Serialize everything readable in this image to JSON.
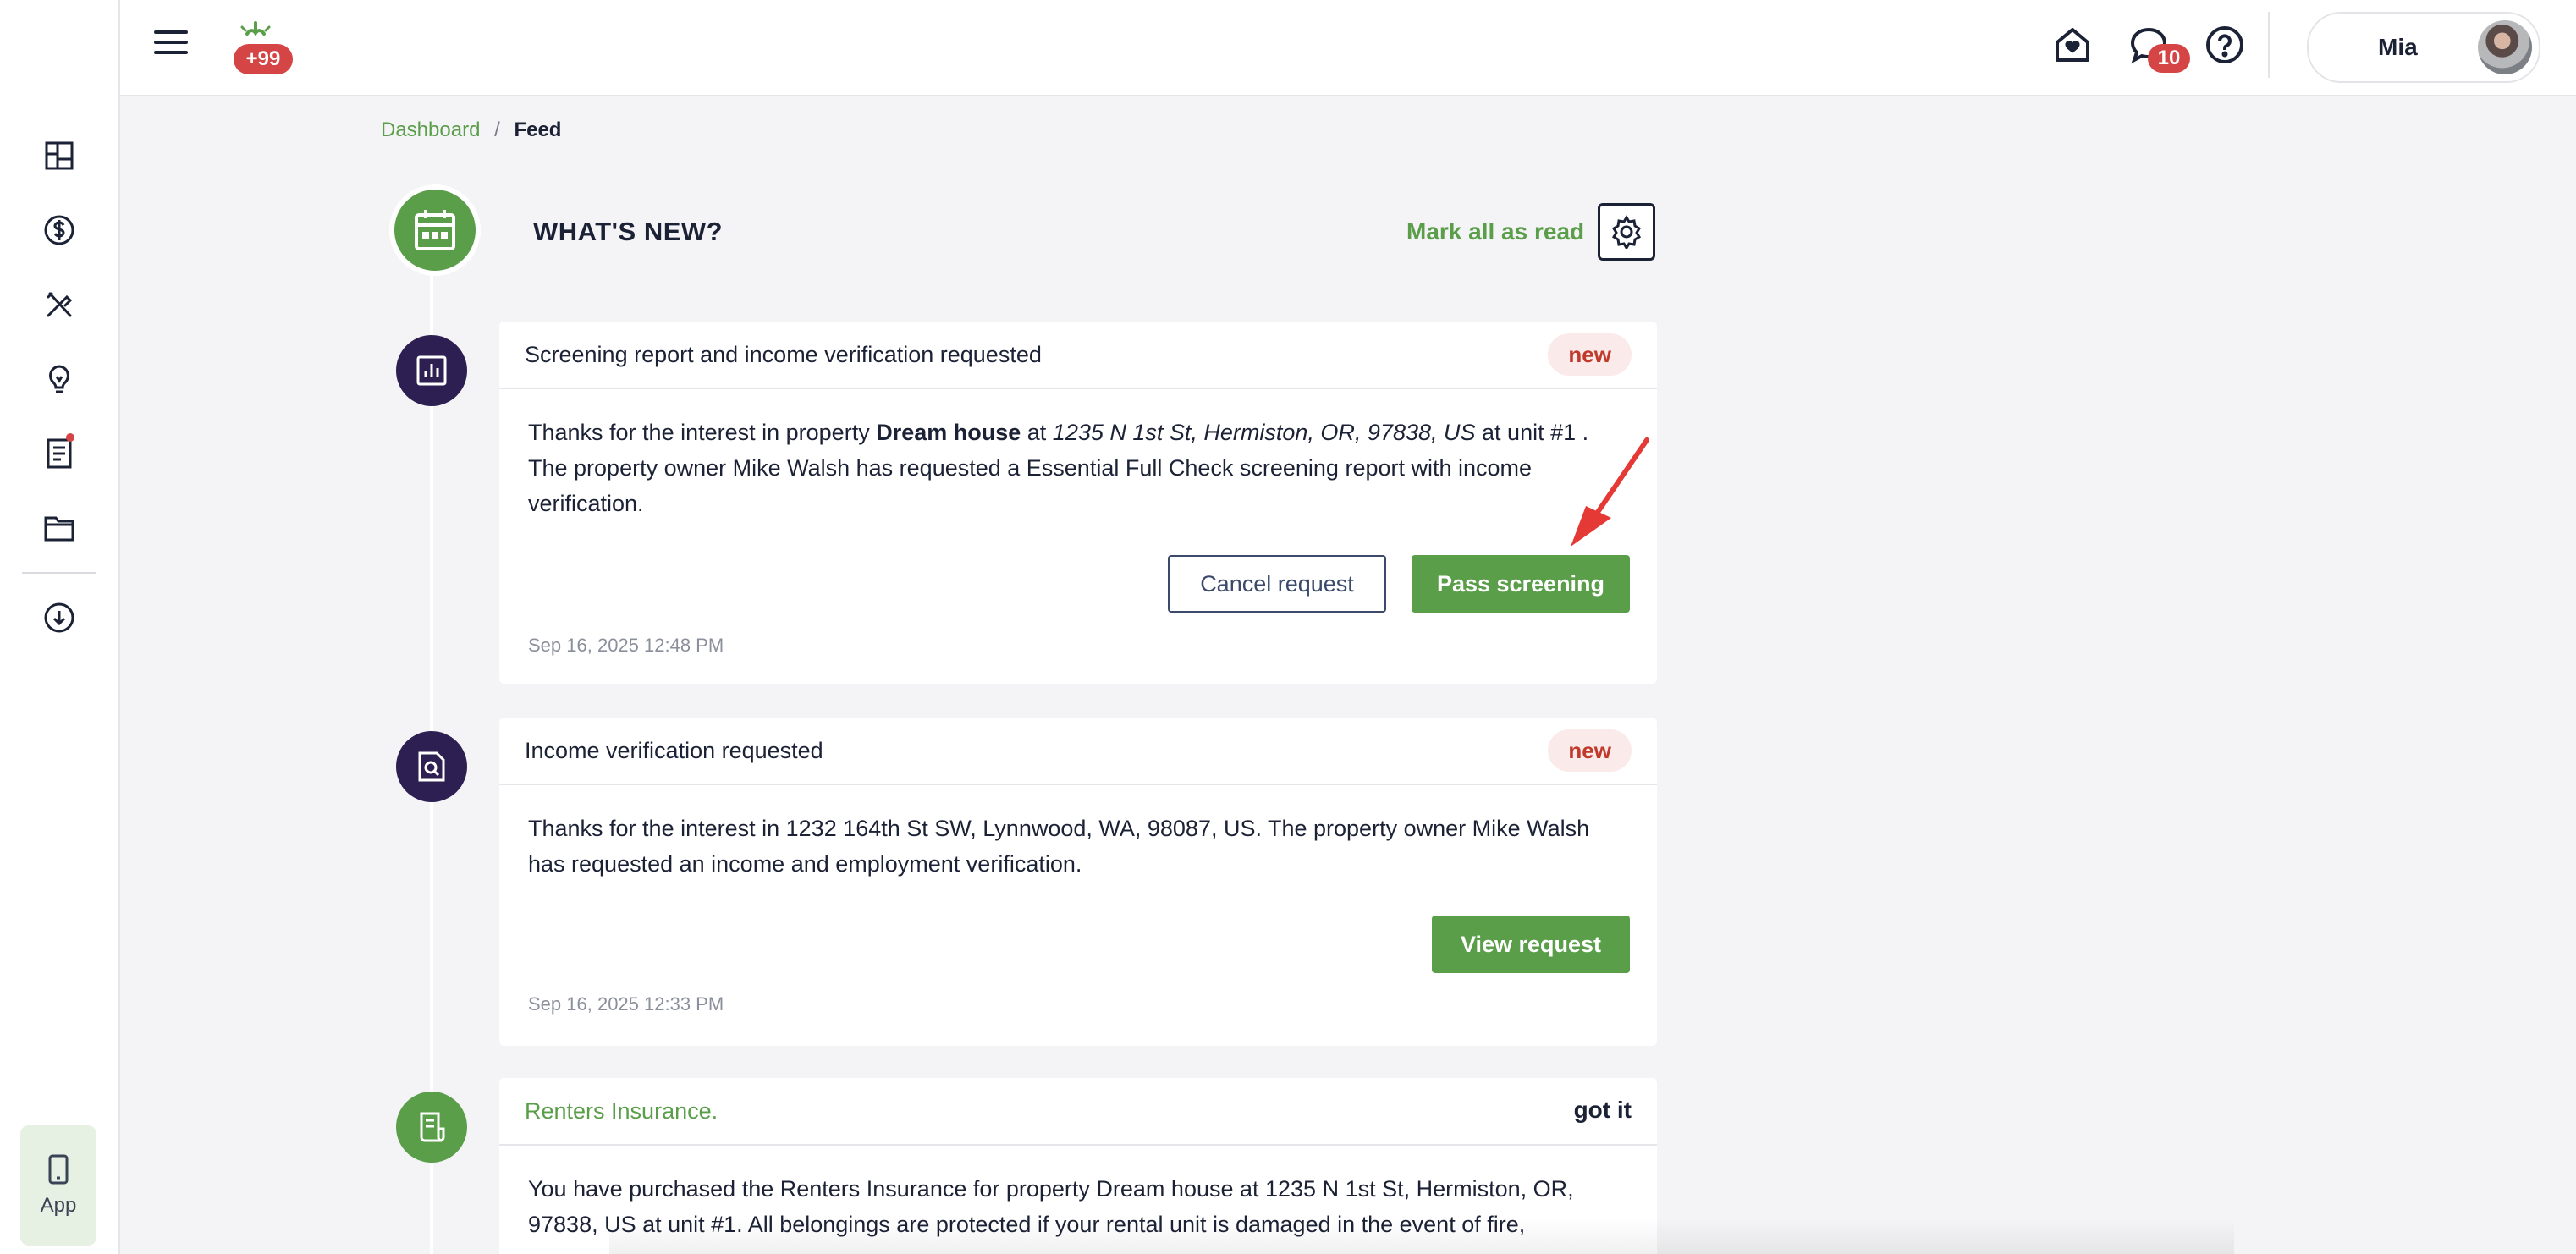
{
  "topbar": {
    "notifications_badge": "+99",
    "messages_badge": "10",
    "user_name": "Mia"
  },
  "sidebar": {
    "items": [
      {
        "icon": "dashboard-icon"
      },
      {
        "icon": "dollar-icon"
      },
      {
        "icon": "tools-icon"
      },
      {
        "icon": "lightbulb-icon"
      },
      {
        "icon": "document-icon",
        "has_dot": true
      },
      {
        "icon": "folder-icon"
      },
      {
        "icon": "cloud-download-icon"
      }
    ],
    "app_label": "App"
  },
  "breadcrumb": {
    "link": "Dashboard",
    "separator": "/",
    "current": "Feed"
  },
  "feed": {
    "title": "WHAT'S NEW?",
    "mark_all_read": "Mark all as read",
    "items": [
      {
        "title": "Screening report and income verification requested",
        "badge": "new",
        "body_1": "Thanks for the interest in property ",
        "property_name": "Dream house",
        "body_2": " at ",
        "address": "1235 N 1st St, Hermiston, OR, 97838, US",
        "body_3": " at unit #1 .",
        "body_4": "The property owner Mike Walsh has requested a Essential Full Check screening report with income",
        "body_5": "verification.",
        "cancel_label": "Cancel request",
        "primary_label": "Pass screening",
        "timestamp": "Sep 16, 2025 12:48 PM"
      },
      {
        "title": "Income verification requested",
        "badge": "new",
        "body_1": "Thanks for the interest in 1232 164th St SW, Lynnwood, WA, 98087, US. The property owner Mike Walsh",
        "body_2": "has requested an income and employment verification.",
        "primary_label": "View request",
        "timestamp": "Sep 16, 2025 12:33 PM"
      },
      {
        "title": "Renters Insurance.",
        "badge": "got it",
        "body_1": "You have purchased the Renters Insurance for property Dream house at 1235 N 1st St, Hermiston, OR,",
        "body_2": "97838, US at unit #1. All belongings are protected if your rental unit is damaged in the event of fire,"
      }
    ]
  },
  "colors": {
    "brand_green": "#5a9e4a",
    "badge_red": "#d64545",
    "dark_purple": "#2e1f52",
    "text_dark": "#1c2236"
  }
}
